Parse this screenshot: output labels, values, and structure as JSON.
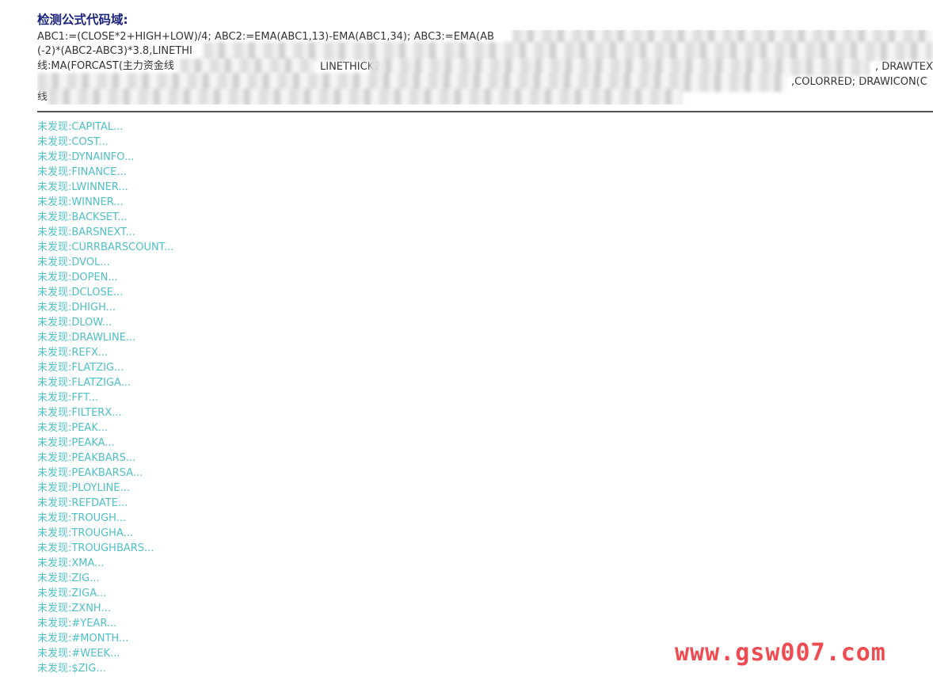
{
  "heading": "检测公式代码域:",
  "code_lines": [
    "ABC1:=(CLOSE*2+HIGH+LOW)/4; ABC2:=EMA(ABC1,13)-EMA(ABC1,34); ABC3:=EMA(AB",
    "(-2)*(ABC2-ABC3)*3.8,LINETHI",
    "线:MA(FORCAST(主力资金线",
    "LINETHICK2;",
    ", DRAWTEXT",
    ",COLORRED; DRAWICON(C",
    "线"
  ],
  "results": [
    "未发现:CAPITAL...",
    "未发现:COST...",
    "未发现:DYNAINFO...",
    "未发现:FINANCE...",
    "未发现:LWINNER...",
    "未发现:WINNER...",
    "未发现:BACKSET...",
    "未发现:BARSNEXT...",
    "未发现:CURRBARSCOUNT...",
    "未发现:DVOL...",
    "未发现:DOPEN...",
    "未发现:DCLOSE...",
    "未发现:DHIGH...",
    "未发现:DLOW...",
    "未发现:DRAWLINE...",
    "未发现:REFX...",
    "未发现:FLATZIG...",
    "未发现:FLATZIGA...",
    "未发现:FFT...",
    "未发现:FILTERX...",
    "未发现:PEAK...",
    "未发现:PEAKA...",
    "未发现:PEAKBARS...",
    "未发现:PEAKBARSA...",
    "未发现:PLOYLINE...",
    "未发现:REFDATE...",
    "未发现:TROUGH...",
    "未发现:TROUGHA...",
    "未发现:TROUGHBARS...",
    "未发现:XMA...",
    "未发现:ZIG...",
    "未发现:ZIGA...",
    "未发现:ZXNH...",
    "未发现:#YEAR...",
    "未发现:#MONTH...",
    "未发现:#WEEK...",
    "未发现:$ZIG..."
  ],
  "watermark": "www.gsw007.com",
  "colors": {
    "heading": "#1a237e",
    "code_text": "#333333",
    "result_text": "#4ec0c6",
    "divider": "#555555",
    "watermark": "#ef4b53"
  }
}
